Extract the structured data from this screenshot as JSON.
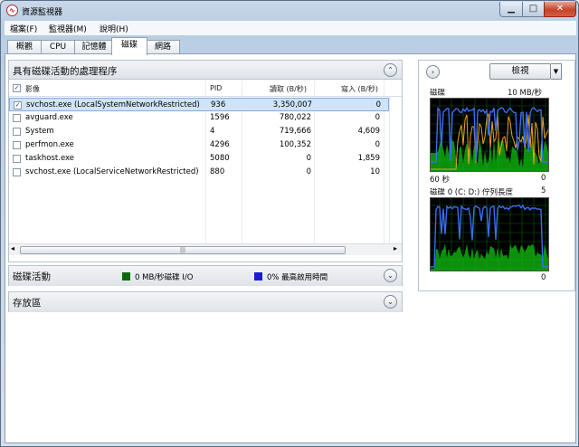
{
  "window": {
    "title": "資源監視器",
    "controls": {
      "minimize": "▁",
      "maximize": "□",
      "close": "✕"
    }
  },
  "menu": [
    "檔案(F)",
    "監視器(M)",
    "說明(H)"
  ],
  "tabs": [
    "概觀",
    "CPU",
    "記憶體",
    "磁碟",
    "網路"
  ],
  "active_tab": "磁碟",
  "process_section": {
    "title": "具有磁碟活動的處理程序",
    "columns": [
      "影像",
      "PID",
      "讀取 (B/秒)",
      "寫入 (B/秒)"
    ],
    "rows": [
      {
        "image": "svchost.exe (LocalSystemNetworkRestricted)",
        "pid": "936",
        "read": "3,350,007",
        "write": "0",
        "checked": true,
        "selected": true
      },
      {
        "image": "avguard.exe",
        "pid": "1596",
        "read": "780,022",
        "write": "0",
        "checked": false,
        "selected": false
      },
      {
        "image": "System",
        "pid": "4",
        "read": "719,666",
        "write": "4,609",
        "checked": false,
        "selected": false
      },
      {
        "image": "perfmon.exe",
        "pid": "4296",
        "read": "100,352",
        "write": "0",
        "checked": false,
        "selected": false
      },
      {
        "image": "taskhost.exe",
        "pid": "5080",
        "read": "0",
        "write": "1,859",
        "checked": false,
        "selected": false
      },
      {
        "image": "svchost.exe (LocalServiceNetworkRestricted)",
        "pid": "880",
        "read": "0",
        "write": "10",
        "checked": false,
        "selected": false
      }
    ],
    "header_checked": true,
    "scroll_left": "◂",
    "scroll_right": "▸",
    "scroll_grip": "|||"
  },
  "disk_activity": {
    "title": "磁碟活動",
    "legend1": "0 MB/秒磁碟 I/O",
    "legend1_color": "#0b6b0b",
    "legend2": "0% 最高啟用時間",
    "legend2_color": "#1a1ad0"
  },
  "storage": {
    "title": "存放區"
  },
  "collapse_glyph": "⌄",
  "expand_glyph": "⌃",
  "right_pane": {
    "nav_glyph": "›",
    "view_button": "檢視",
    "view_dropdown": "▼",
    "graph1": {
      "label": "磁碟",
      "max": "10 MB/秒",
      "time": "60 秒",
      "min": "0"
    },
    "graph2": {
      "label": "磁碟 0 (C: D:) 佇列長度",
      "max": "5",
      "min": "0"
    }
  },
  "colors": {
    "green": "#10c010",
    "blue": "#3a6df0",
    "orange": "#f0a020",
    "grid": "#0a5a0a"
  }
}
